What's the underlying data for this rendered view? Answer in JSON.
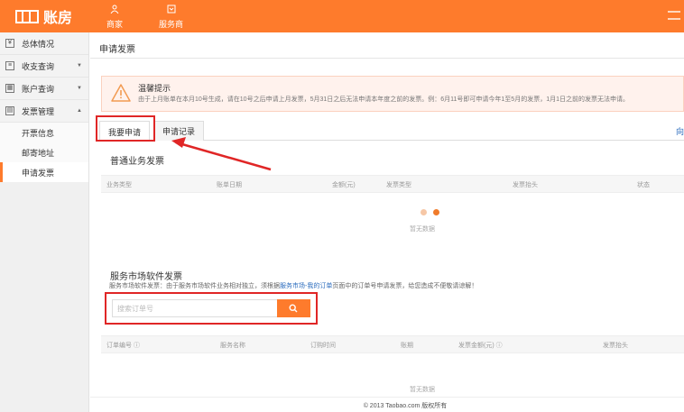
{
  "header": {
    "logo_text": "账房",
    "nav": [
      {
        "label": "商家",
        "icon": "user-icon"
      },
      {
        "label": "服务商",
        "icon": "service-provider-icon"
      }
    ]
  },
  "sidebar": {
    "items": [
      {
        "label": "总体情况",
        "icon": "overview-icon"
      },
      {
        "label": "收支查询",
        "icon": "ledger-icon"
      },
      {
        "label": "账户查询",
        "icon": "account-icon"
      },
      {
        "label": "发票管理",
        "icon": "invoice-icon"
      }
    ],
    "subitems": [
      {
        "label": "开票信息"
      },
      {
        "label": "邮寄地址"
      },
      {
        "label": "申请发票"
      }
    ]
  },
  "main": {
    "title": "申请发票",
    "tip": {
      "title": "温馨提示",
      "text": "由于上月账单在本月10号生成，请在10号之后申请上月发票，5月31日之后无法申请本年度之前的发票。例：6月11号即可申请今年1至5月的发票，1月1日之前的发票无法申请。"
    },
    "tabs": [
      {
        "label": "我要申请"
      },
      {
        "label": "申请记录"
      }
    ],
    "tab_right": "向",
    "normal": {
      "title": "普通业务发票",
      "columns": [
        "业务类型",
        "账单日期",
        "金额(元)",
        "发票类型",
        "发票抬头",
        "状态"
      ],
      "empty": "暂无数据"
    },
    "market": {
      "title": "服务市场软件发票",
      "desc_prefix": "服务市场软件发票：由于服务市场软件业务相对独立，须根据",
      "desc_link": "服务市场-我的订单",
      "desc_suffix": "页面中的订单号申请发票，给您造成不便敬请谅解！",
      "search_placeholder": "搜索订单号",
      "columns": [
        "订单编号 ⓘ",
        "服务名称",
        "订购时间",
        "账期",
        "发票金额(元) ⓘ",
        "发票抬头"
      ],
      "empty": "暂无数据"
    }
  },
  "footer": {
    "text": "© 2013 Taobao.com 版权所有"
  },
  "colors": {
    "accent": "#fe7b2c",
    "highlight": "#e02626",
    "link": "#2a6bbd"
  }
}
